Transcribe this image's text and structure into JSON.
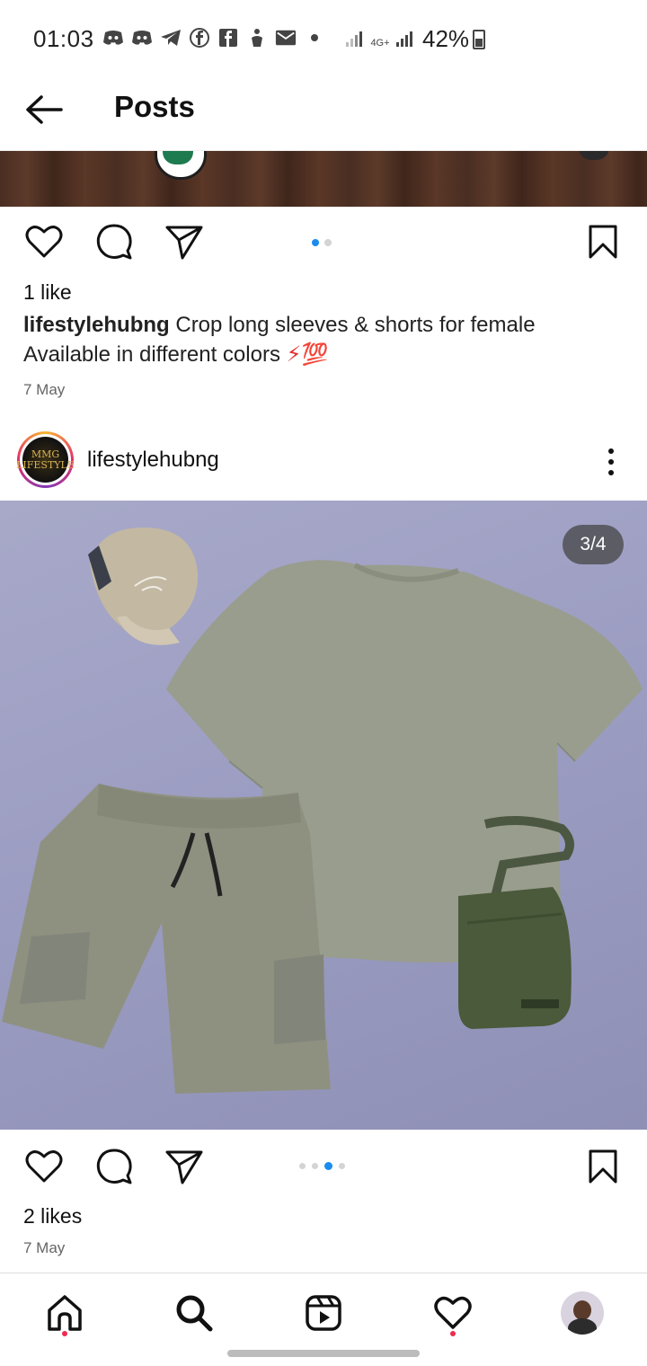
{
  "status_bar": {
    "time": "01:03",
    "battery": "42%",
    "network": "4G+",
    "icons": [
      "discord-icon",
      "discord-icon",
      "telegram-icon",
      "facebook-icon",
      "facebook-icon",
      "notification-icon",
      "mail-icon",
      "dot-icon"
    ]
  },
  "header": {
    "title": "Posts",
    "back_icon": "arrow-left-icon"
  },
  "post1": {
    "likes": "1 like",
    "username": "lifestylehubng",
    "caption_line1": "Crop long sleeves & shorts for female",
    "caption_line2": "Available in different colors",
    "caption_emoji": "⚡💯",
    "date": "7 May",
    "carousel": {
      "count": 2,
      "active": 1
    }
  },
  "post2": {
    "username": "lifestylehubng",
    "avatar_text": "MMG LIFESTYLE",
    "image_counter": "3/4",
    "likes": "2 likes",
    "date": "7 May",
    "carousel": {
      "count": 4,
      "active": 3
    }
  },
  "bottom_nav": {
    "items": [
      "home-icon",
      "search-icon",
      "reels-icon",
      "heart-icon",
      "profile-avatar"
    ]
  },
  "colors": {
    "accent_blue": "#1a8cf0",
    "notification_red": "#ef2a4d"
  }
}
